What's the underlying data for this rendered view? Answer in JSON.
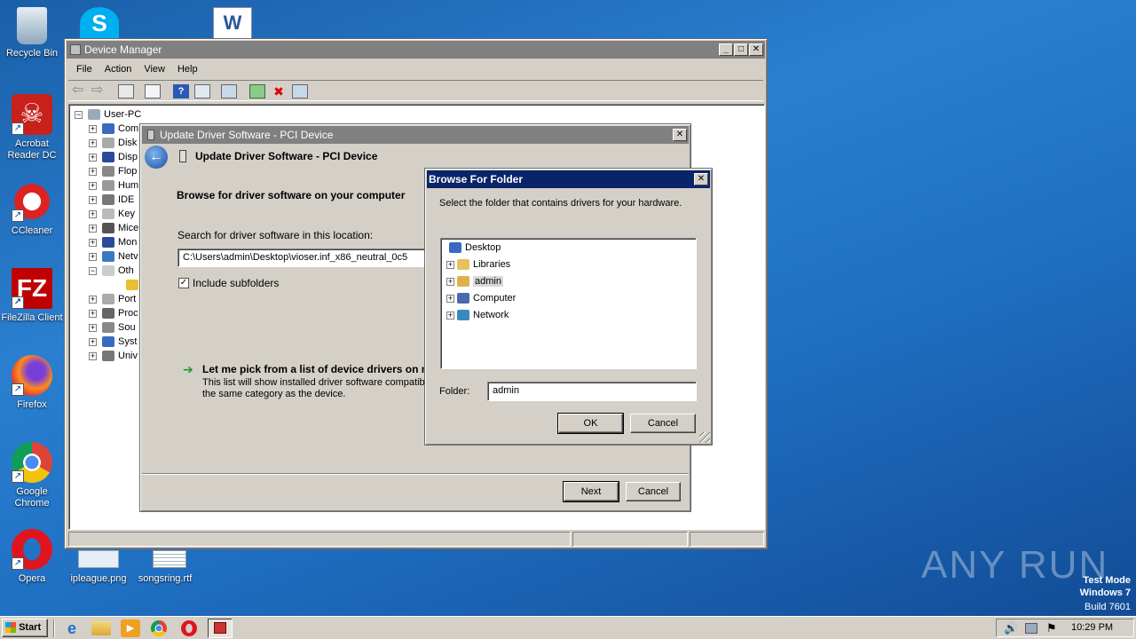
{
  "desktop": {
    "icons": [
      {
        "label": "Recycle Bin",
        "icon": "recycle-bin-icon"
      },
      {
        "label": "Acrobat Reader DC",
        "icon": "acrobat-icon"
      },
      {
        "label": "CCleaner",
        "icon": "ccleaner-icon"
      },
      {
        "label": "FileZilla Client",
        "icon": "filezilla-icon"
      },
      {
        "label": "Firefox",
        "icon": "firefox-icon"
      },
      {
        "label": "Google Chrome",
        "icon": "chrome-icon"
      },
      {
        "label": "Opera",
        "icon": "opera-icon"
      }
    ],
    "files": [
      {
        "label": "ipleague.png"
      },
      {
        "label": "songsring.rtf"
      }
    ],
    "watermark": {
      "brand": "ANY RUN",
      "mode": "Test Mode",
      "os": "Windows 7",
      "build": "Build 7601"
    }
  },
  "device_manager": {
    "title": "Device Manager",
    "menu": [
      "File",
      "Action",
      "View",
      "Help"
    ],
    "root": "User-PC",
    "nodes": [
      "Com",
      "Disk",
      "Disp",
      "Flop",
      "Hum",
      "IDE",
      "Key",
      "Mice",
      "Mon",
      "Netv",
      "Oth",
      "",
      "Port",
      "Proc",
      "Sou",
      "Syst",
      "Univ"
    ]
  },
  "update_driver": {
    "title": "Update Driver Software - PCI Device",
    "header": "Update Driver Software - PCI Device",
    "heading": "Browse for driver software on your computer",
    "search_label": "Search for driver software in this location:",
    "path_value": "C:\\Users\\admin\\Desktop\\vioser.inf_x86_neutral_0c5",
    "include_subfolders": "Include subfolders",
    "pick_title": "Let me pick from a list of device drivers on m",
    "pick_desc1": "This list will show installed driver software compatible",
    "pick_desc2": "the same category as the device.",
    "next": "Next",
    "cancel": "Cancel"
  },
  "browse_folder": {
    "title": "Browse For Folder",
    "instruction": "Select the folder that contains drivers for your hardware.",
    "tree": [
      {
        "label": "Desktop",
        "expandable": false,
        "selected": false
      },
      {
        "label": "Libraries",
        "expandable": true,
        "selected": false
      },
      {
        "label": "admin",
        "expandable": true,
        "selected": true
      },
      {
        "label": "Computer",
        "expandable": true,
        "selected": false
      },
      {
        "label": "Network",
        "expandable": true,
        "selected": false
      }
    ],
    "folder_label": "Folder:",
    "folder_value": "admin",
    "ok": "OK",
    "cancel": "Cancel"
  },
  "taskbar": {
    "start": "Start",
    "clock": "10:29 PM"
  }
}
